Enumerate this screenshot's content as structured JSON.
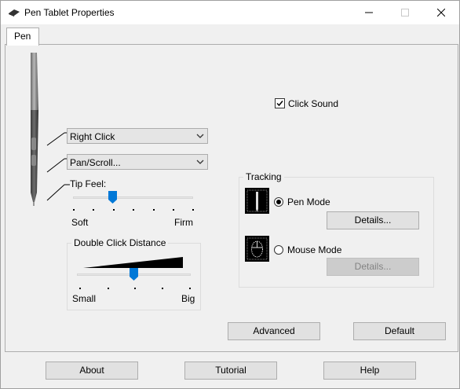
{
  "window": {
    "title": "Pen Tablet Properties"
  },
  "tabs": [
    {
      "label": "Pen"
    }
  ],
  "pen": {
    "upper_button": {
      "value": "Right Click"
    },
    "lower_button": {
      "value": "Pan/Scroll..."
    },
    "tip_feel": {
      "label": "Tip Feel:",
      "min_label": "Soft",
      "max_label": "Firm",
      "level_fraction": 0.33
    },
    "double_click": {
      "label": "Double Click Distance",
      "min_label": "Small",
      "max_label": "Big",
      "level_fraction": 0.5
    },
    "click_sound": {
      "label": "Click Sound",
      "checked": true
    },
    "tracking": {
      "label": "Tracking",
      "pen_mode": {
        "label": "Pen Mode",
        "selected": true,
        "details": "Details..."
      },
      "mouse_mode": {
        "label": "Mouse Mode",
        "selected": false,
        "details": "Details..."
      }
    },
    "advanced_label": "Advanced",
    "default_label": "Default"
  },
  "footer": {
    "about_label": "About",
    "tutorial_label": "Tutorial",
    "help_label": "Help"
  },
  "colors": {
    "slider_thumb": "#0078d7"
  }
}
